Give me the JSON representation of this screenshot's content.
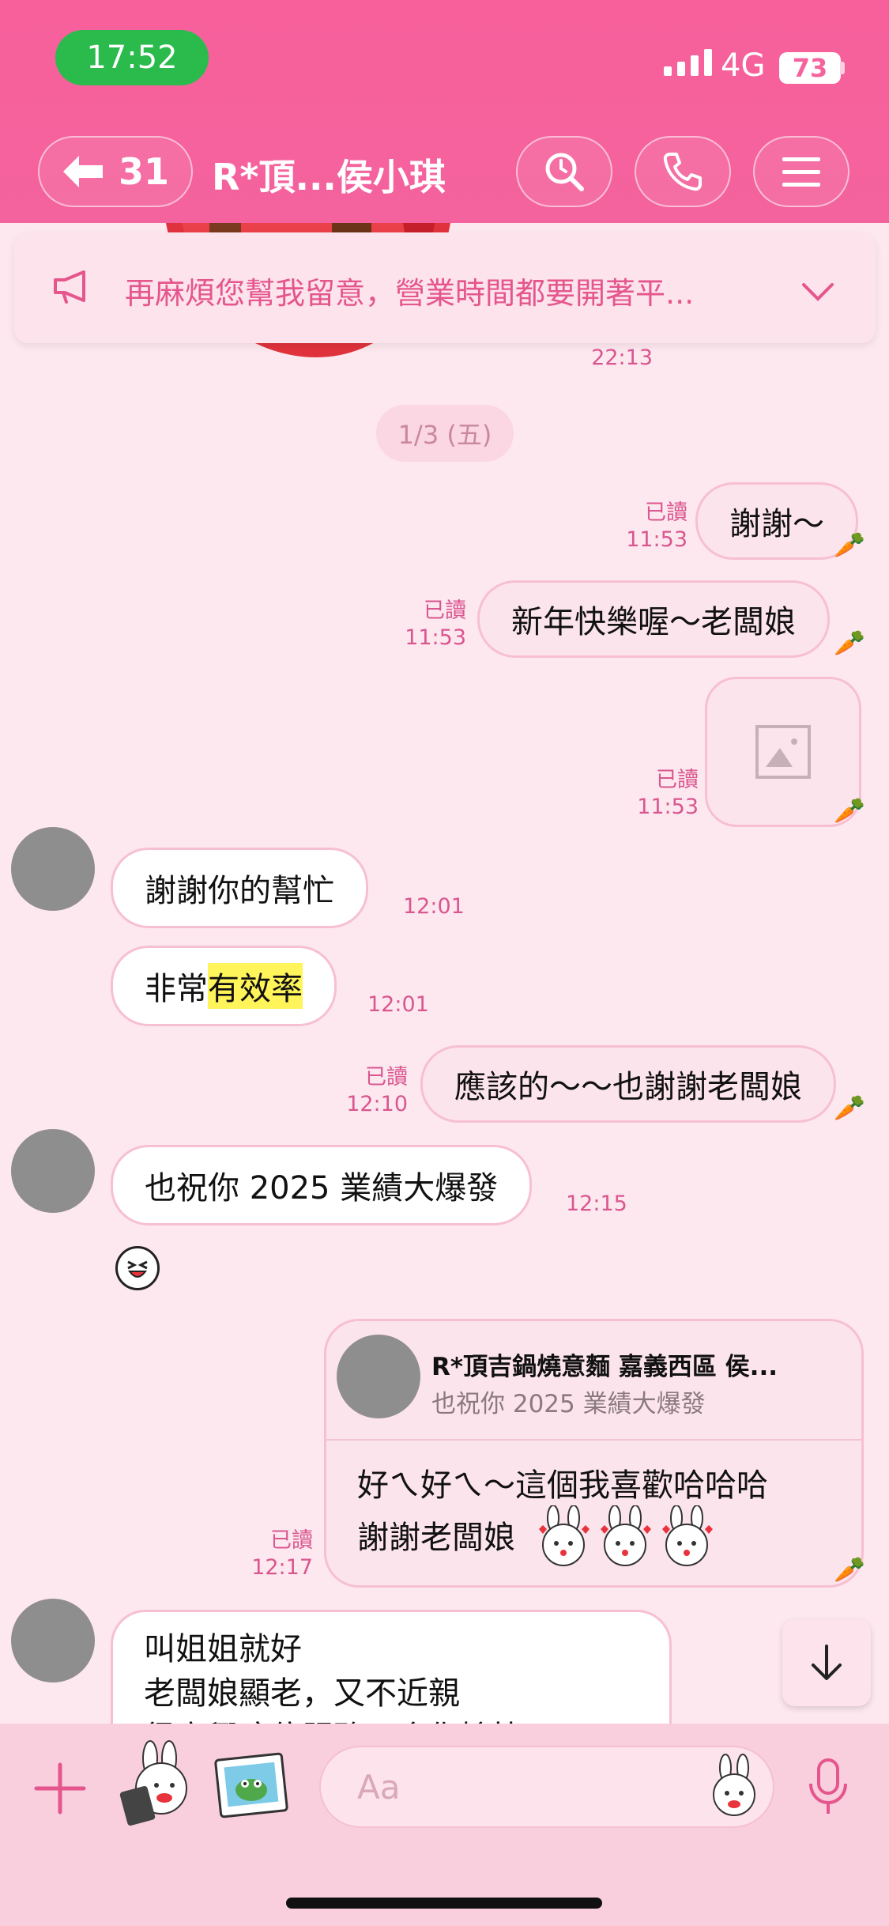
{
  "status_bar": {
    "time": "17:52",
    "network": "4G",
    "battery": "73"
  },
  "header": {
    "back_count": "31",
    "title": "R*頂...侯小琪",
    "icons": [
      "back-arrow-icon",
      "search-icon",
      "phone-icon",
      "menu-icon"
    ]
  },
  "announcement": {
    "text": "再麻煩您幫我留意，營業時間都要開著平..."
  },
  "prev_message_time": "22:13",
  "date_chip": "1/3 (五)",
  "messages": [
    {
      "side": "out",
      "read": "已讀",
      "time": "11:53",
      "text": "謝謝～"
    },
    {
      "side": "out",
      "read": "已讀",
      "time": "11:53",
      "text": "新年快樂喔～老闆娘"
    },
    {
      "side": "out",
      "read": "已讀",
      "time": "11:53",
      "text": "",
      "type": "image"
    },
    {
      "side": "in",
      "time": "12:01",
      "text": "謝謝你的幫忙"
    },
    {
      "side": "in",
      "time": "12:01",
      "text_before": "非常",
      "text_highlight": "有效率"
    },
    {
      "side": "out",
      "read": "已讀",
      "time": "12:10",
      "text": "應該的～～也謝謝老闆娘"
    },
    {
      "side": "in",
      "time": "12:15",
      "text": "也祝你 2025 業績大爆發"
    },
    {
      "side": "out",
      "read": "已讀",
      "time": "12:17",
      "reply_to_name": "R*頂吉鍋燒意麵 嘉義西區 侯...",
      "reply_to_text": "也祝你 2025 業績大爆發",
      "text_line1": "好ㄟ好ㄟ～這個我喜歡哈哈哈",
      "text_line2": "謝謝老闆娘"
    },
    {
      "side": "in",
      "line1": "叫姐姐就好",
      "line2": "老闆娘顯老，又不近親",
      "line3": "很高興這位服務，令你愉快"
    }
  ],
  "input": {
    "placeholder": "Aa"
  },
  "colors": {
    "header": "#f4639e",
    "accent": "#e4568c",
    "background": "#fde8ef",
    "highlight": "#fff45a",
    "status_green": "#2bbb4d"
  }
}
